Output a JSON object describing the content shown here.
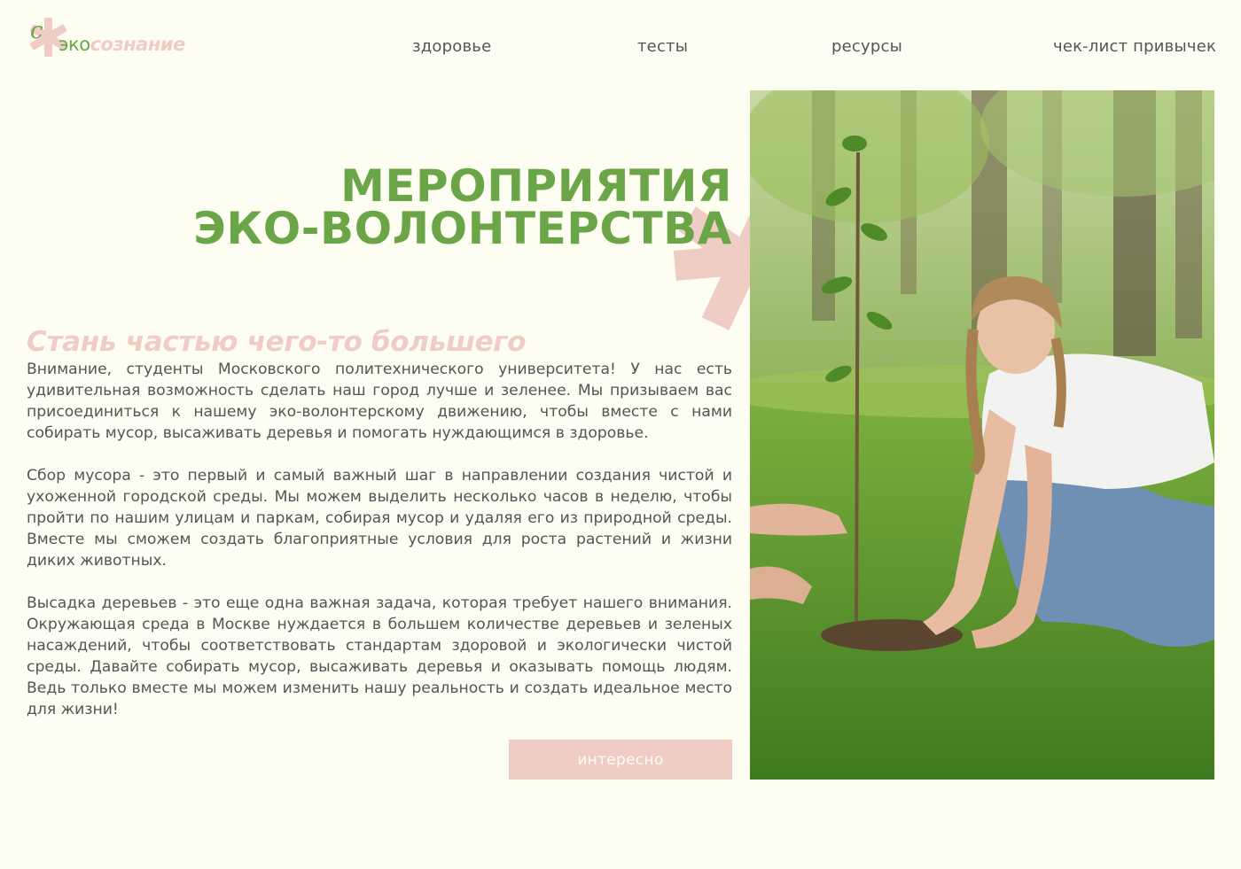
{
  "header": {
    "logo": {
      "prefix": "эко",
      "suffix": "сознание",
      "monogram": "с"
    },
    "nav": [
      {
        "label": "здоровье"
      },
      {
        "label": "тесты"
      },
      {
        "label": "ресурсы"
      },
      {
        "label": "чек-лист привычек"
      }
    ]
  },
  "hero": {
    "title_line1": "МЕРОПРИЯТИЯ",
    "title_line2": "ЭКО-ВОЛОНТЕРСТВА",
    "subtitle": "Стань частью чего-то большего",
    "paragraphs": [
      "Внимание, студенты Московского политехнического университета! У нас есть удивительная возможность сделать наш город лучше и зеленее. Мы призываем вас присоединиться к нашему эко-волонтерскому движению, чтобы вместе с нами собирать мусор, высаживать деревья и помогать нуждающимся в здоровье.",
      "Сбор мусора - это первый и самый важный шаг в направлении создания чистой и ухоженной городской среды. Мы можем выделить несколько часов в неделю, чтобы пройти по нашим улицам и паркам, собирая мусор и удаляя его из природной среды. Вместе мы сможем создать благоприятные условия для роста растений и жизни диких животных.",
      "Высадка деревьев - это еще одна важная задача, которая требует нашего внимания. Окружающая среда в Москве нуждается в большем количестве деревьев и зеленых насаждений, чтобы соответствовать стандартам здоровой и экологически чистой среды. Давайте собирать мусор, высаживать деревья и оказывать помощь людям. Ведь только вместе мы можем изменить нашу реальность и создать идеальное место для жизни!"
    ],
    "cta_label": "интересно",
    "photo_icon": "volunteer-planting-tree-photo"
  },
  "colors": {
    "background": "#fefdf2",
    "green": "#6aa548",
    "pink": "#efcdc5",
    "text": "#555555"
  }
}
